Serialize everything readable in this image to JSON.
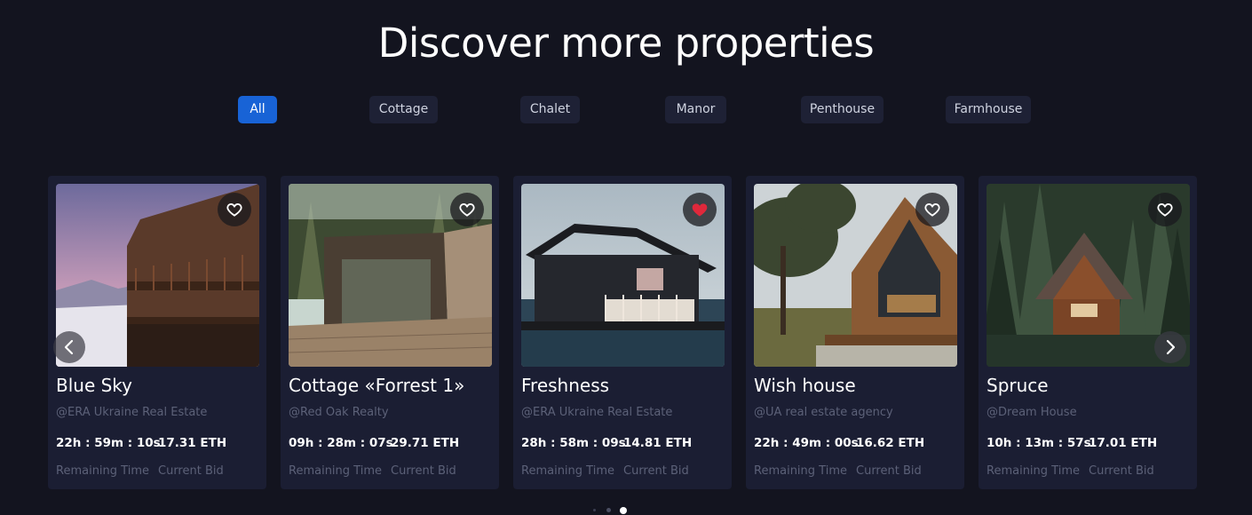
{
  "heading": "Discover more properties",
  "filters": [
    "All",
    "Cottage",
    "Chalet",
    "Manor",
    "Penthouse",
    "Farmhouse"
  ],
  "active_filter": "All",
  "labels": {
    "remaining": "Remaining Time",
    "bid": "Current Bid"
  },
  "cards": [
    {
      "name": "Blue Sky",
      "agency": "@ERA Ukraine Real Estate",
      "time": "22h : 59m : 10s",
      "bid": "17.31 ETH",
      "favorited": false,
      "image": "snowy-chalet-sunset"
    },
    {
      "name": "Cottage «Forrest 1»",
      "agency": "@Red Oak Realty",
      "time": "09h : 28m : 07s",
      "bid": "29.71 ETH",
      "favorited": false,
      "image": "modern-cottage-forest"
    },
    {
      "name": "Freshness",
      "agency": "@ERA Ukraine Real Estate",
      "time": "28h : 58m : 09s",
      "bid": "14.81 ETH",
      "favorited": true,
      "image": "lake-house"
    },
    {
      "name": "Wish house",
      "agency": "@UA real estate agency",
      "time": "22h : 49m : 00s",
      "bid": "16.62 ETH",
      "favorited": false,
      "image": "a-frame-wood-house"
    },
    {
      "name": "Spruce",
      "agency": "@Dream House",
      "time": "10h : 13m : 57s",
      "bid": "17.01 ETH",
      "favorited": false,
      "image": "forest-a-frame-cabin"
    }
  ],
  "pagination": {
    "count": 3,
    "active": 3
  },
  "colors": {
    "background": "#13141f",
    "card": "#1b1e33",
    "accent": "#1863d6",
    "favorite": "#e0283b"
  }
}
